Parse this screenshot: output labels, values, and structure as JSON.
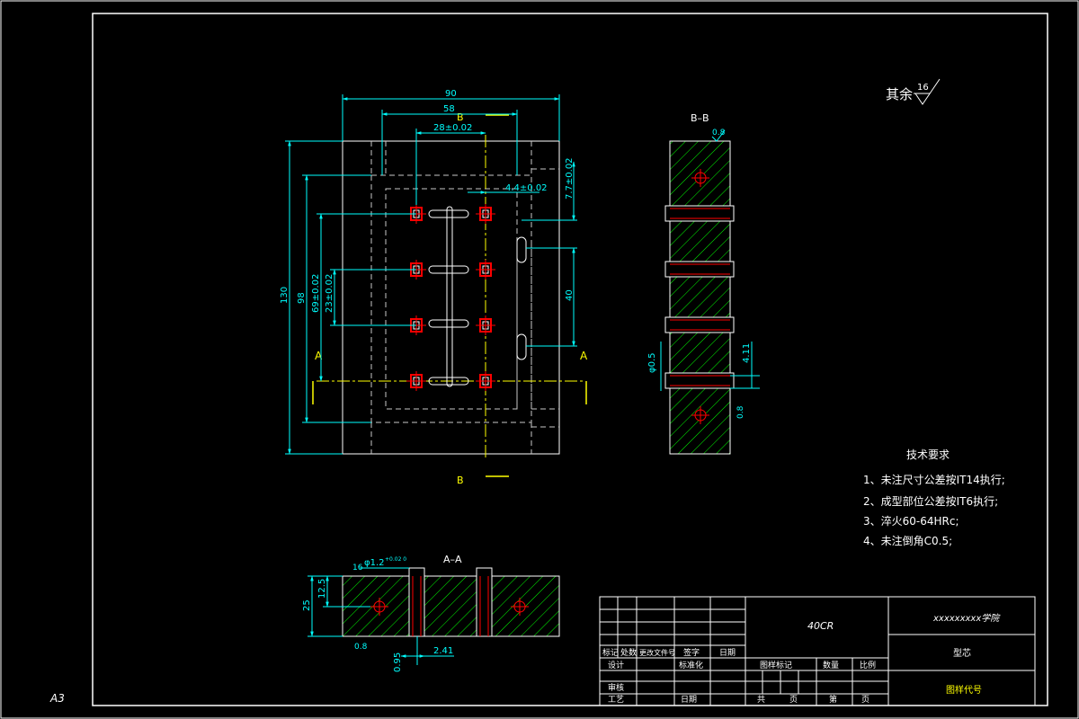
{
  "sheet": {
    "size_label": "A3"
  },
  "surface_finish": {
    "label": "其余",
    "value": "16"
  },
  "main_view": {
    "section_letter_b": "B",
    "section_letter_a": "A",
    "dims": {
      "width_overall": "90",
      "width_58": "58",
      "width_28": "28±0.02",
      "offset_4_4": "4.4±0.02",
      "offset_7_7": "7.7±0.02",
      "height_130": "130",
      "height_98": "98",
      "height_69": "69±0.02",
      "height_23": "23±0.02",
      "spacing_40": "40"
    }
  },
  "section_bb": {
    "title": "B–B",
    "finish_top": "0.8",
    "dia": "φ0.5",
    "dim_4_11": "4.11",
    "finish_bottom": "0.8"
  },
  "section_aa": {
    "title": "A–A",
    "dia": "φ1.2",
    "tol": "+0.02 0",
    "finish_left": "16",
    "dim_12_5": "12.5",
    "dim_25": "25",
    "finish_bottom": "0.8",
    "dim_0_95": "0.95",
    "dim_2_41": "2.41"
  },
  "tech_req": {
    "title": "技术要求",
    "items": [
      "1、未注尺寸公差按IT14执行;",
      "2、成型部位公差按IT6执行;",
      "3、淬火60-64HRc;",
      "4、未注倒角C0.5;"
    ]
  },
  "title_block": {
    "material": "40CR",
    "school": "xxxxxxxxx学院",
    "part_name": "型芯",
    "drawing_number": "图样代号",
    "row_labels": [
      "标记",
      "处数",
      "更改文件号",
      "签字",
      "日期"
    ],
    "design": "设计",
    "standardize": "标准化",
    "review": "审核",
    "process": "工艺",
    "date": "日期",
    "drawing_mark": "图样标记",
    "quantity": "数量",
    "scale": "比例",
    "total": "共",
    "sheet_word": "页",
    "number_word": "第",
    "page_word": "页"
  },
  "colors": {
    "frame": "#ffffff",
    "dimension": "#00ffff",
    "hatch": "#00ff00",
    "center": "#ffff00",
    "hole": "#ff0000",
    "hidden": "#c8c8c8"
  }
}
